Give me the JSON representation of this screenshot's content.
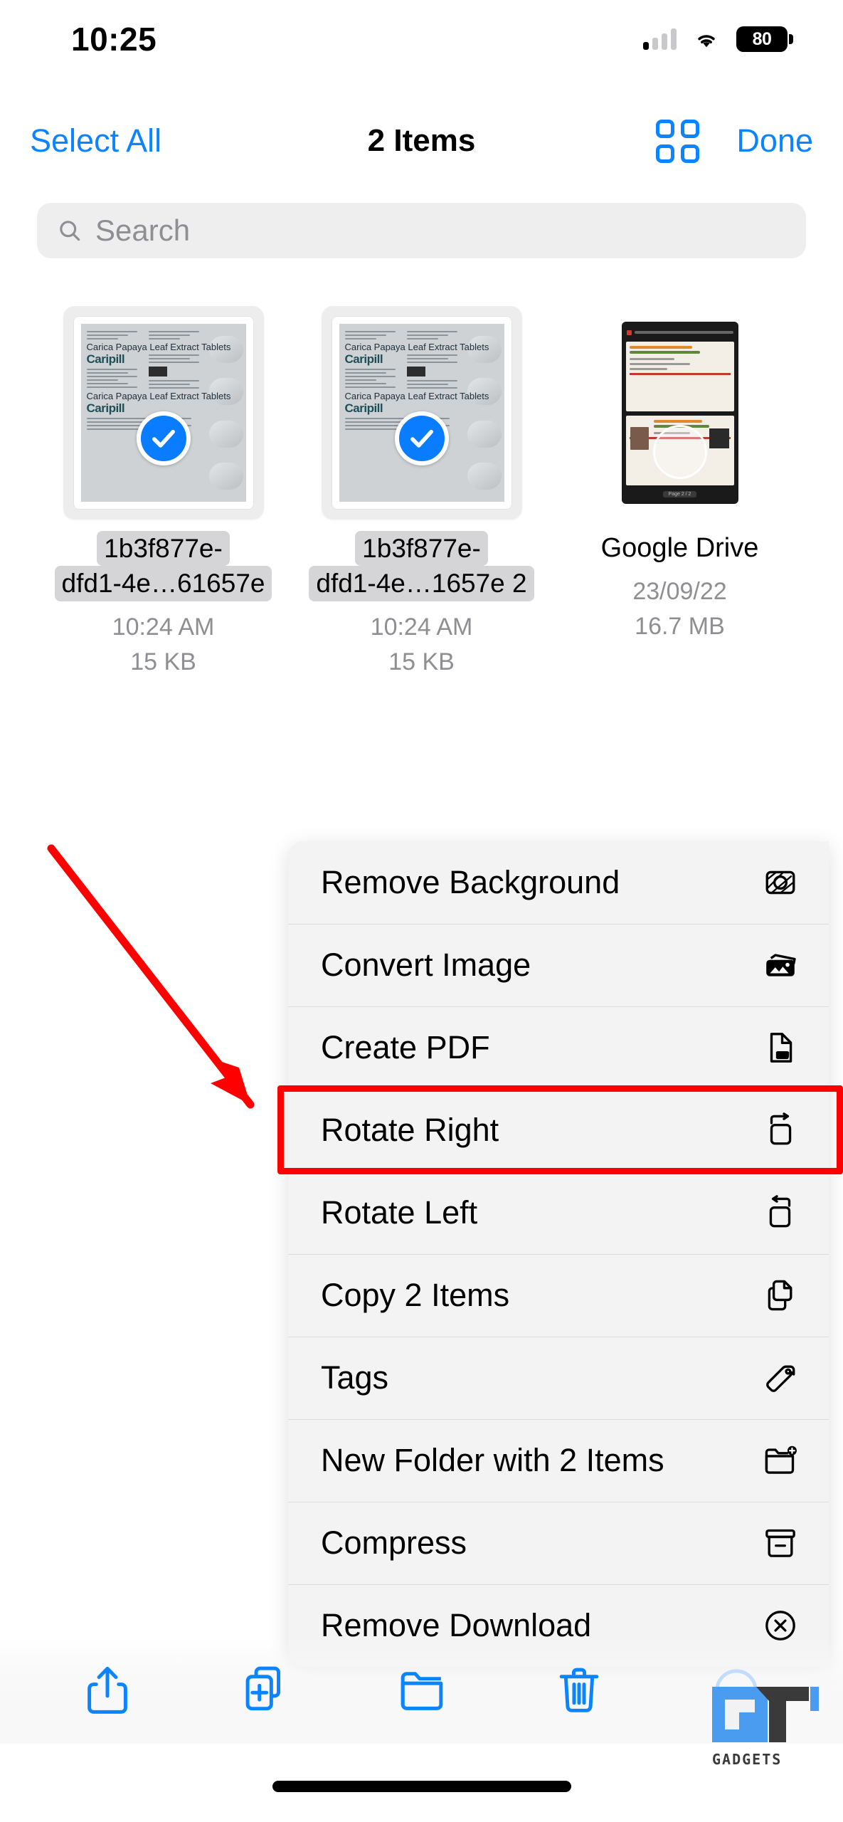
{
  "status_bar": {
    "time": "10:25",
    "battery_level": "80",
    "signal_icon": "cellular-signal-icon",
    "wifi_icon": "wifi-icon",
    "battery_icon": "battery-icon"
  },
  "nav_bar": {
    "select_all_label": "Select All",
    "title": "2 Items",
    "grid_view_icon": "grid-view-icon",
    "done_label": "Done"
  },
  "search": {
    "placeholder": "Search",
    "icon": "search-icon",
    "value": ""
  },
  "files": [
    {
      "name_line1": "1b3f877e-",
      "name_line2": "dfd1-4e…61657e",
      "time": "10:24 AM",
      "size": "15 KB",
      "selected": true,
      "thumbnail_kind": "image",
      "thumbnail_text": {
        "title": "Carica Papaya Leaf Extract Tablets",
        "brand": "Caripill"
      }
    },
    {
      "name_line1": "1b3f877e-",
      "name_line2": "dfd1-4e…1657e 2",
      "time": "10:24 AM",
      "size": "15 KB",
      "selected": true,
      "thumbnail_kind": "image",
      "thumbnail_text": {
        "title": "Carica Papaya Leaf Extract Tablets",
        "brand": "Caripill"
      }
    },
    {
      "name_line1": "Google Drive",
      "name_line2": "",
      "time": "23/09/22",
      "size": "16.7 MB",
      "selected": false,
      "thumbnail_kind": "screenshot",
      "thumbnail_text": {
        "footer": "Page 2 / 2"
      }
    }
  ],
  "context_menu": {
    "items": [
      {
        "label": "Remove Background",
        "icon": "remove-background-icon",
        "highlighted": false
      },
      {
        "label": "Convert Image",
        "icon": "convert-image-icon",
        "highlighted": false
      },
      {
        "label": "Create PDF",
        "icon": "create-pdf-icon",
        "highlighted": true
      },
      {
        "label": "Rotate Right",
        "icon": "rotate-right-icon",
        "highlighted": false
      },
      {
        "label": "Rotate Left",
        "icon": "rotate-left-icon",
        "highlighted": false
      },
      {
        "label": "Copy 2 Items",
        "icon": "copy-icon",
        "highlighted": false
      },
      {
        "label": "Tags",
        "icon": "tag-icon",
        "highlighted": false
      },
      {
        "label": "New Folder with 2 Items",
        "icon": "new-folder-icon",
        "highlighted": false
      },
      {
        "label": "Compress",
        "icon": "compress-icon",
        "highlighted": false
      },
      {
        "label": "Remove Download",
        "icon": "remove-download-icon",
        "highlighted": false
      }
    ]
  },
  "annotation": {
    "highlight_color": "#ff0000",
    "arrow_color": "#ff0000",
    "target": "Create PDF"
  },
  "toolbar": {
    "items": [
      {
        "icon": "share-icon",
        "name": "share-button"
      },
      {
        "icon": "duplicate-icon",
        "name": "duplicate-button"
      },
      {
        "icon": "folder-icon",
        "name": "move-to-folder-button"
      },
      {
        "icon": "trash-icon",
        "name": "delete-button"
      },
      {
        "icon": "more-icon",
        "name": "more-button"
      }
    ]
  },
  "watermark": {
    "text": "GADGETS",
    "logo": "gt-logo"
  },
  "colors": {
    "accent_blue": "#0a84ff",
    "selection_blue": "#0a7cff",
    "menu_bg": "#f3f3f3",
    "search_bg": "#eeeeef",
    "secondary_text": "#8e8e93",
    "highlight_red": "#ff0000"
  }
}
